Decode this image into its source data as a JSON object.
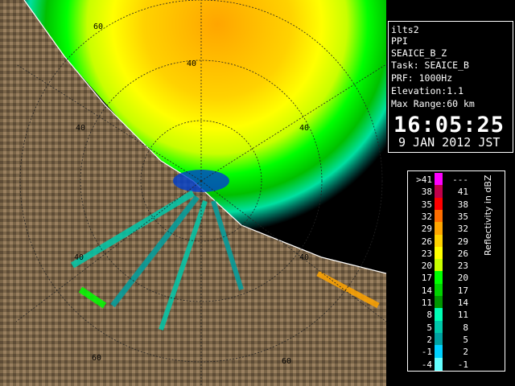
{
  "info": {
    "radar": "ilts2",
    "product": "PPI",
    "scan": "SEAICE_B_Z",
    "task": "Task: SEAICE_B",
    "prf": "PRF: 1000Hz",
    "elevation": "Elevation:1.1",
    "max_range": "Max Range:60 km",
    "time": "16:05:25",
    "date": "9 JAN 2012 JST"
  },
  "legend": {
    "title": "Reflectivity in dBZ",
    "rows": [
      {
        "lo": ">41",
        "hi": "---",
        "color": "#ff00ff"
      },
      {
        "lo": "38",
        "hi": "41",
        "color": "#c0004b"
      },
      {
        "lo": "35",
        "hi": "38",
        "color": "#ff0000"
      },
      {
        "lo": "32",
        "hi": "35",
        "color": "#ff6e00"
      },
      {
        "lo": "29",
        "hi": "32",
        "color": "#ffa500"
      },
      {
        "lo": "26",
        "hi": "29",
        "color": "#ffd200"
      },
      {
        "lo": "23",
        "hi": "26",
        "color": "#ffff00"
      },
      {
        "lo": "20",
        "hi": "23",
        "color": "#c8ff00"
      },
      {
        "lo": "17",
        "hi": "20",
        "color": "#00ff00"
      },
      {
        "lo": "14",
        "hi": "17",
        "color": "#00d200"
      },
      {
        "lo": "11",
        "hi": "14",
        "color": "#009600"
      },
      {
        "lo": "8",
        "hi": "11",
        "color": "#00ffb4"
      },
      {
        "lo": "5",
        "hi": "8",
        "color": "#00c8aa"
      },
      {
        "lo": "2",
        "hi": "5",
        "color": "#00a0a0"
      },
      {
        "lo": "-1",
        "hi": "2",
        "color": "#00d2ff"
      },
      {
        "lo": "-4",
        "hi": "-1",
        "color": "#64ffff"
      }
    ]
  },
  "map": {
    "range_labels": [
      "60",
      "40",
      "40",
      "40",
      "40",
      "40",
      "60",
      "60"
    ],
    "colors": {
      "land": "#7a6548",
      "sea": "#000000",
      "echo_outer": "#00b400",
      "echo_mid": "#ffff00",
      "echo_core": "#ffa500"
    }
  }
}
